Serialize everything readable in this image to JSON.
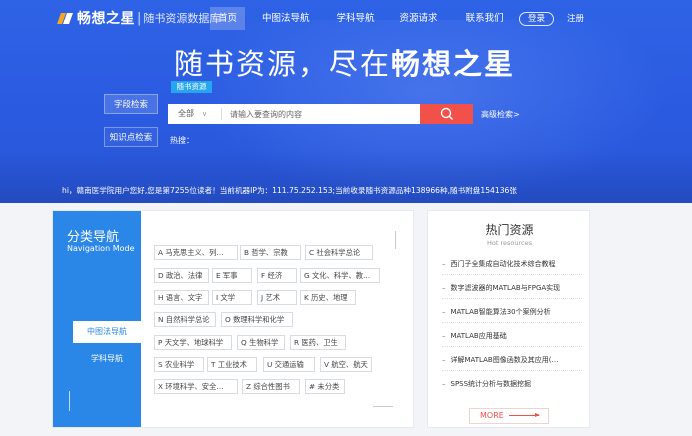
{
  "header": {
    "logo_name": "畅想之星",
    "logo_sep": "|",
    "logo_sub": "随书资源数据库",
    "nav": [
      "首页",
      "中图法导航",
      "学科导航",
      "资源请求",
      "联系我们"
    ],
    "login": "登录",
    "register": "注册"
  },
  "hero": {
    "slogan_prefix": "随书资源，尽在",
    "slogan_brand": "畅想之星"
  },
  "search": {
    "tab_label": "随书资源",
    "side_buttons": [
      "字段检索",
      "知识点检索"
    ],
    "scope": "全部",
    "placeholder": "请输入要查询的内容",
    "advanced": "高级检索>",
    "hot_label": "热搜："
  },
  "ticker": "hi，赣南医学院用户您好,您是第7255位读者！当前机器IP为：111.75.252.153;当前收录随书资源品种138966种,随书附盘154136张",
  "category": {
    "title": "分类导航",
    "subtitle": "Navigation Mode",
    "nav": [
      "中图法导航",
      "学科导航"
    ],
    "tags": [
      "A 马克思主义、列…",
      "B 哲学、宗教",
      "C 社会科学总论",
      "D 政治、法律",
      "E 军事",
      "F 经济",
      "G 文化、科学、教…",
      "H 语言、文字",
      "I 文学",
      "J 艺术",
      "K 历史、地理",
      "N 自然科学总论",
      "O 数理科学和化学",
      "P 天文学、地球科学",
      "Q 生物科学",
      "R 医药、卫生",
      "S 农业科学",
      "T 工业技术",
      "U 交通运输",
      "V 航空、航天",
      "X 环境科学、安全…",
      "Z 综合性图书",
      "# 未分类"
    ]
  },
  "hot_resources": {
    "title": "热门资源",
    "subtitle": "Hot resources",
    "items": [
      "西门子全集成自动化技术综合教程",
      "数字滤波器的MATLAB与FPGA实现",
      "MATLAB智能算法30个案例分析",
      "MATLAB应用基础",
      "详解MATLAB图像函数及其应用(…",
      "SPSS统计分析与数据挖掘"
    ],
    "more": "MORE"
  },
  "colors": {
    "hero_blue": "#2f63e6",
    "search_red": "#f2514a",
    "panel_blue": "#2a86e7",
    "tab_cyan": "#27a6f0"
  }
}
